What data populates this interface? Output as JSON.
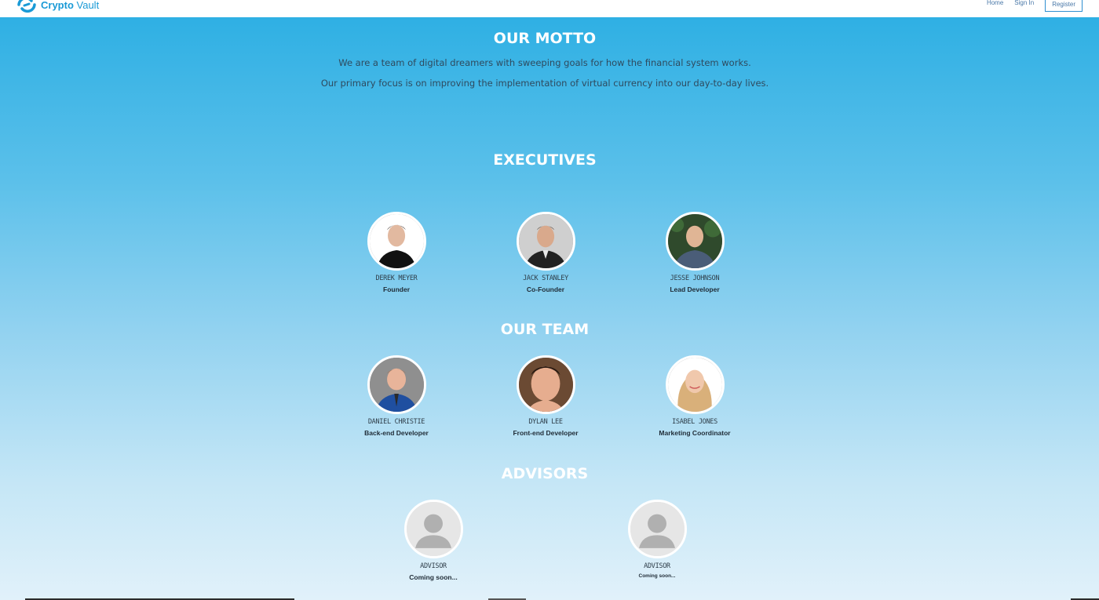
{
  "nav": {
    "brand_bold": "Crypto",
    "brand_light": "Vault",
    "links": [
      "Home",
      "Sign In"
    ],
    "register": "Register"
  },
  "motto": {
    "title": "OUR MOTTO",
    "line1": "We are a team of digital dreamers with sweeping goals for how the financial system works.",
    "line2": "Our primary focus is on improving the implementation of virtual currency into our day-to-day lives."
  },
  "executives": {
    "title": "EXECUTIVES",
    "members": [
      {
        "name": "DEREK MEYER",
        "role": "Founder"
      },
      {
        "name": "JACK STANLEY",
        "role": "Co-Founder"
      },
      {
        "name": "JESSE JOHNSON",
        "role": "Lead Developer"
      }
    ]
  },
  "team": {
    "title": "OUR TEAM",
    "members": [
      {
        "name": "DANIEL CHRISTIE",
        "role": "Back-end Developer"
      },
      {
        "name": "DYLAN LEE",
        "role": "Front-end Developer"
      },
      {
        "name": "ISABEL JONES",
        "role": "Marketing Coordinator"
      }
    ]
  },
  "advisors": {
    "title": "ADVISORS",
    "members": [
      {
        "name": "ADVISOR",
        "role": "Coming soon..."
      },
      {
        "name": "ADVISOR",
        "role": "Coming soon..."
      }
    ]
  },
  "colors": {
    "brand": "#1a9ad6",
    "bg_top": "#2aaee3",
    "bg_bottom": "#e1f1fa"
  }
}
